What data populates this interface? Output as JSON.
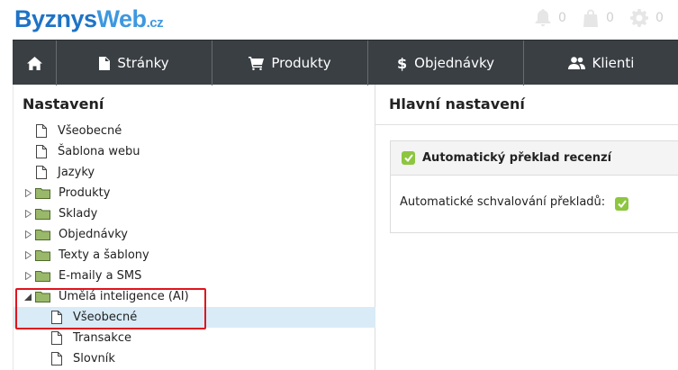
{
  "logo": {
    "part1": "Byznys",
    "part2": "Web",
    "part3": ".cz"
  },
  "top_counters": {
    "notifications": "0",
    "cart": "0",
    "settings": "0"
  },
  "nav": {
    "stranky": "Stránky",
    "produkty": "Produkty",
    "objednavky": "Objednávky",
    "klienti": "Klienti"
  },
  "sidebar": {
    "title": "Nastavení",
    "items": [
      {
        "label": "Všeobecné"
      },
      {
        "label": "Šablona webu"
      },
      {
        "label": "Jazyky"
      },
      {
        "label": "Produkty"
      },
      {
        "label": "Sklady"
      },
      {
        "label": "Objednávky"
      },
      {
        "label": "Texty a šablony"
      },
      {
        "label": "E-maily a SMS"
      },
      {
        "label": "Umělá inteligence (AI)"
      },
      {
        "label": "Všeobecné"
      },
      {
        "label": "Transakce"
      },
      {
        "label": "Slovník"
      }
    ]
  },
  "main": {
    "title": "Hlavní nastavení",
    "panel": {
      "heading": "Automatický překlad recenzí",
      "field_label": "Automatické schvalování překladů:",
      "field_checked": true
    }
  },
  "colors": {
    "nav_bg": "#3a3f44",
    "accent_green": "#8dc63f",
    "selection": "#d8ebf7",
    "highlight": "#e0141e"
  }
}
